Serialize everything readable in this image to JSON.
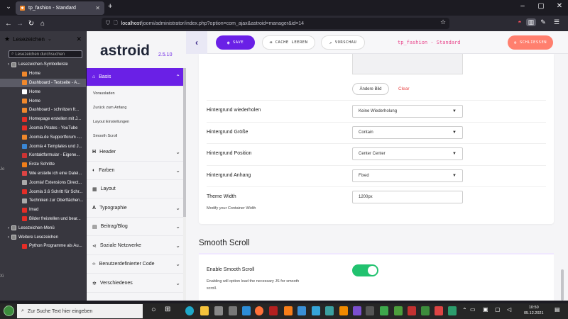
{
  "browser": {
    "tab_title": "tp_fashion - Standard",
    "url_prefix": "localhost",
    "url_path": "/joomi/administrator/index.php?option=com_ajax&astroid=manager&id=14"
  },
  "bookmarks": {
    "header": "Lesezeichen",
    "search_placeholder": "Lesezeichen durchsuchen",
    "items": [
      {
        "label": "Lesezeichen-Symbolleiste",
        "indent": 0,
        "kind": "folder",
        "color": "#888"
      },
      {
        "label": "Home",
        "indent": 1,
        "kind": "site",
        "color": "#f0882c"
      },
      {
        "label": "Dashboard - Testseite - A...",
        "indent": 1,
        "kind": "site",
        "color": "#f0882c",
        "selected": true
      },
      {
        "label": "Home",
        "indent": 1,
        "kind": "site",
        "color": "#ffffff"
      },
      {
        "label": "Home",
        "indent": 1,
        "kind": "site",
        "color": "#f0882c"
      },
      {
        "label": "Dashboard - schnitzen fr...",
        "indent": 1,
        "kind": "site",
        "color": "#f0882c"
      },
      {
        "label": "Homepage erstellen mit J...",
        "indent": 1,
        "kind": "site",
        "color": "#e52d27"
      },
      {
        "label": "Joomla Pirates - YouTube",
        "indent": 1,
        "kind": "site",
        "color": "#e52d27"
      },
      {
        "label": "Joomla.de Supportforum -...",
        "indent": 1,
        "kind": "site",
        "color": "#f0882c"
      },
      {
        "label": "Joomla 4 Templates und J...",
        "indent": 1,
        "kind": "site",
        "color": "#3a86d4"
      },
      {
        "label": "Kontaktformular - Eigene...",
        "indent": 1,
        "kind": "site",
        "color": "#c33"
      },
      {
        "label": "Erste Schritte",
        "indent": 1,
        "kind": "site",
        "color": "#f07e1a"
      },
      {
        "label": "Wie erstelle ich eine Datei...",
        "indent": 1,
        "kind": "site",
        "color": "#d44"
      },
      {
        "label": "Joomla! Extensions Direct...",
        "indent": 1,
        "kind": "site",
        "color": "#aaa"
      },
      {
        "label": "Joomla 3.6 Schritt für Schr...",
        "indent": 1,
        "kind": "site",
        "color": "#e52d27"
      },
      {
        "label": "Techniken zur Oberflächen...",
        "indent": 1,
        "kind": "site",
        "color": "#aaa"
      },
      {
        "label": "Imad",
        "indent": 1,
        "kind": "site",
        "color": "#e52d27"
      },
      {
        "label": "Bilder freistellen und bear...",
        "indent": 1,
        "kind": "site",
        "color": "#e52d27"
      },
      {
        "label": "Lesezeichen-Menü",
        "indent": 0,
        "kind": "folder",
        "color": "#888"
      },
      {
        "label": "Weitere Lesezeichen",
        "indent": 0,
        "kind": "folder",
        "color": "#888"
      },
      {
        "label": "Python Programme als Au...",
        "indent": 1,
        "kind": "site",
        "color": "#e52d27"
      }
    ]
  },
  "astroid": {
    "logo": "astroid",
    "version": "2.5.10",
    "save": "SAVE",
    "cache": "CACHE LEEREN",
    "preview": "VORSCHAU",
    "close": "SCHLIESSEN",
    "template_title": "tp_fashion - Standard"
  },
  "menu": {
    "basis": "Basis",
    "basis_sub": [
      "Vorausladen",
      "Zurück zum Anfang",
      "Layout Einstellungen",
      "Smooth Scroll"
    ],
    "header": "Header",
    "farben": "Farben",
    "layout": "Layout",
    "typografie": "Typographie",
    "beitrag": "Beitrag/Blog",
    "sozial": "Soziale Netzwerke",
    "code": "Benutzerdefinierter Code",
    "verschiedenes": "Verschiedenes"
  },
  "form": {
    "change_image": "Ändere Bild",
    "clear": "Clear",
    "bg_repeat_label": "Hintergrund wiederholen",
    "bg_repeat_value": "Keine Wiederholung",
    "bg_size_label": "Hintergrund Größe",
    "bg_size_value": "Contain",
    "bg_position_label": "Hintergrund Position",
    "bg_position_value": "Center Center",
    "bg_attach_label": "Hintergrund Anhang",
    "bg_attach_value": "Fixed",
    "theme_width_label": "Theme Width",
    "theme_width_desc": "Modify your Container Width",
    "theme_width_value": "1200px",
    "smooth_scroll_title": "Smooth Scroll",
    "enable_smooth_label": "Enable Smooth Scroll",
    "enable_smooth_desc1": "Enabling will option load the necessary JS for smooth",
    "enable_smooth_desc2": "scroll.",
    "enable_smooth_on": true
  },
  "taskbar": {
    "search_placeholder": "Zur Suche Text hier eingeben",
    "time": "10:50",
    "date": "05.12.2021"
  }
}
